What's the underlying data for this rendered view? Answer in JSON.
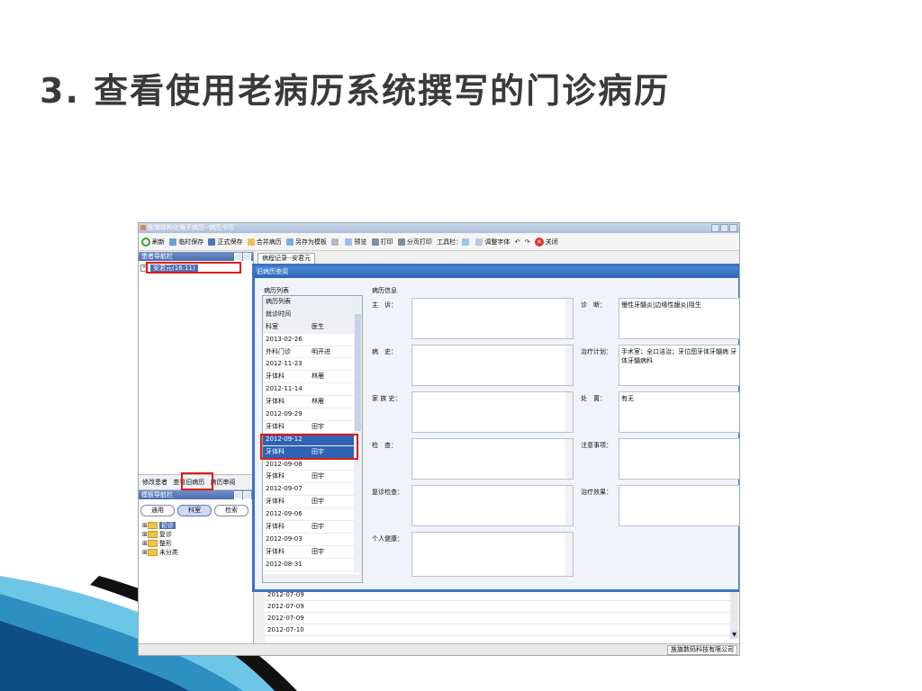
{
  "slide": {
    "title": "3. 查看使用老病历系统撰写的门诊病历"
  },
  "app": {
    "title": "旌旗结构化电子病历--病历书写",
    "toolbar": [
      "刷新",
      "临时保存",
      "正式保存",
      "合并病历",
      "另存为模板",
      "预览",
      "打印",
      "分页打印",
      "工具栏：",
      "调整字体",
      "关闭"
    ],
    "patient_panel": {
      "title": "患者导航栏",
      "patient_node": "安君元(16:11)",
      "buttons": [
        "修改患者",
        "查看旧病历",
        "病历审阅"
      ]
    },
    "template_panel": {
      "title": "模板导航栏",
      "pills": [
        "通用",
        "科室",
        "检索"
      ],
      "tree": [
        "初诊",
        "复诊",
        "整形",
        "未分类"
      ]
    },
    "tab": "病程记录--安君元",
    "bg_dates": [
      "2012-07-09",
      "2012-07-09",
      "2012-07-09",
      "2012-07-10"
    ],
    "status_company": "旌旗数码科技有限公司",
    "dialog": {
      "title": "旧病历查阅",
      "list_label": "病历列表",
      "info_label": "病历信息",
      "list_header": "病历列表",
      "visit_time_header": "就诊时间",
      "col_dept": "科室",
      "col_doctor": "医生",
      "records": [
        {
          "date": "2013-02-26",
          "dept": "外科门诊",
          "doctor": "明开进"
        },
        {
          "date": "2012-11-23",
          "dept": "牙体科",
          "doctor": "林雁"
        },
        {
          "date": "2012-11-14",
          "dept": "牙体科",
          "doctor": "林雁"
        },
        {
          "date": "2012-09-29",
          "dept": "牙体科",
          "doctor": "田宇"
        },
        {
          "date": "2012-09-12",
          "dept": "牙体科",
          "doctor": "田宇"
        },
        {
          "date": "2012-09-08",
          "dept": "牙体科",
          "doctor": "田宇"
        },
        {
          "date": "2012-09-07",
          "dept": "牙体科",
          "doctor": "田宇"
        },
        {
          "date": "2012-09-06",
          "dept": "牙体科",
          "doctor": "田宇"
        },
        {
          "date": "2012-09-03",
          "dept": "牙体科",
          "doctor": "田宇"
        },
        {
          "date": "2012-08-31",
          "dept": "",
          "doctor": ""
        }
      ],
      "selected_date": "2012-09-12",
      "fields": {
        "chief": "主　诉：",
        "history": "病　史：",
        "family": "家 族 史：",
        "exam": "检　查：",
        "reexam": "复诊检查：",
        "personal": "个人健康：",
        "diagnosis": "诊　断：",
        "plan": "治疗计划：",
        "disposal": "处　置：",
        "notes": "注意事项：",
        "effect": "治疗效果："
      },
      "values": {
        "diagnosis": "慢性牙髓炎|边缘性龈炎|阻生",
        "plan": "手术室；全口洁治；牙位图牙体牙髓病 牙体牙髓病科",
        "disposal": "有无"
      }
    }
  }
}
